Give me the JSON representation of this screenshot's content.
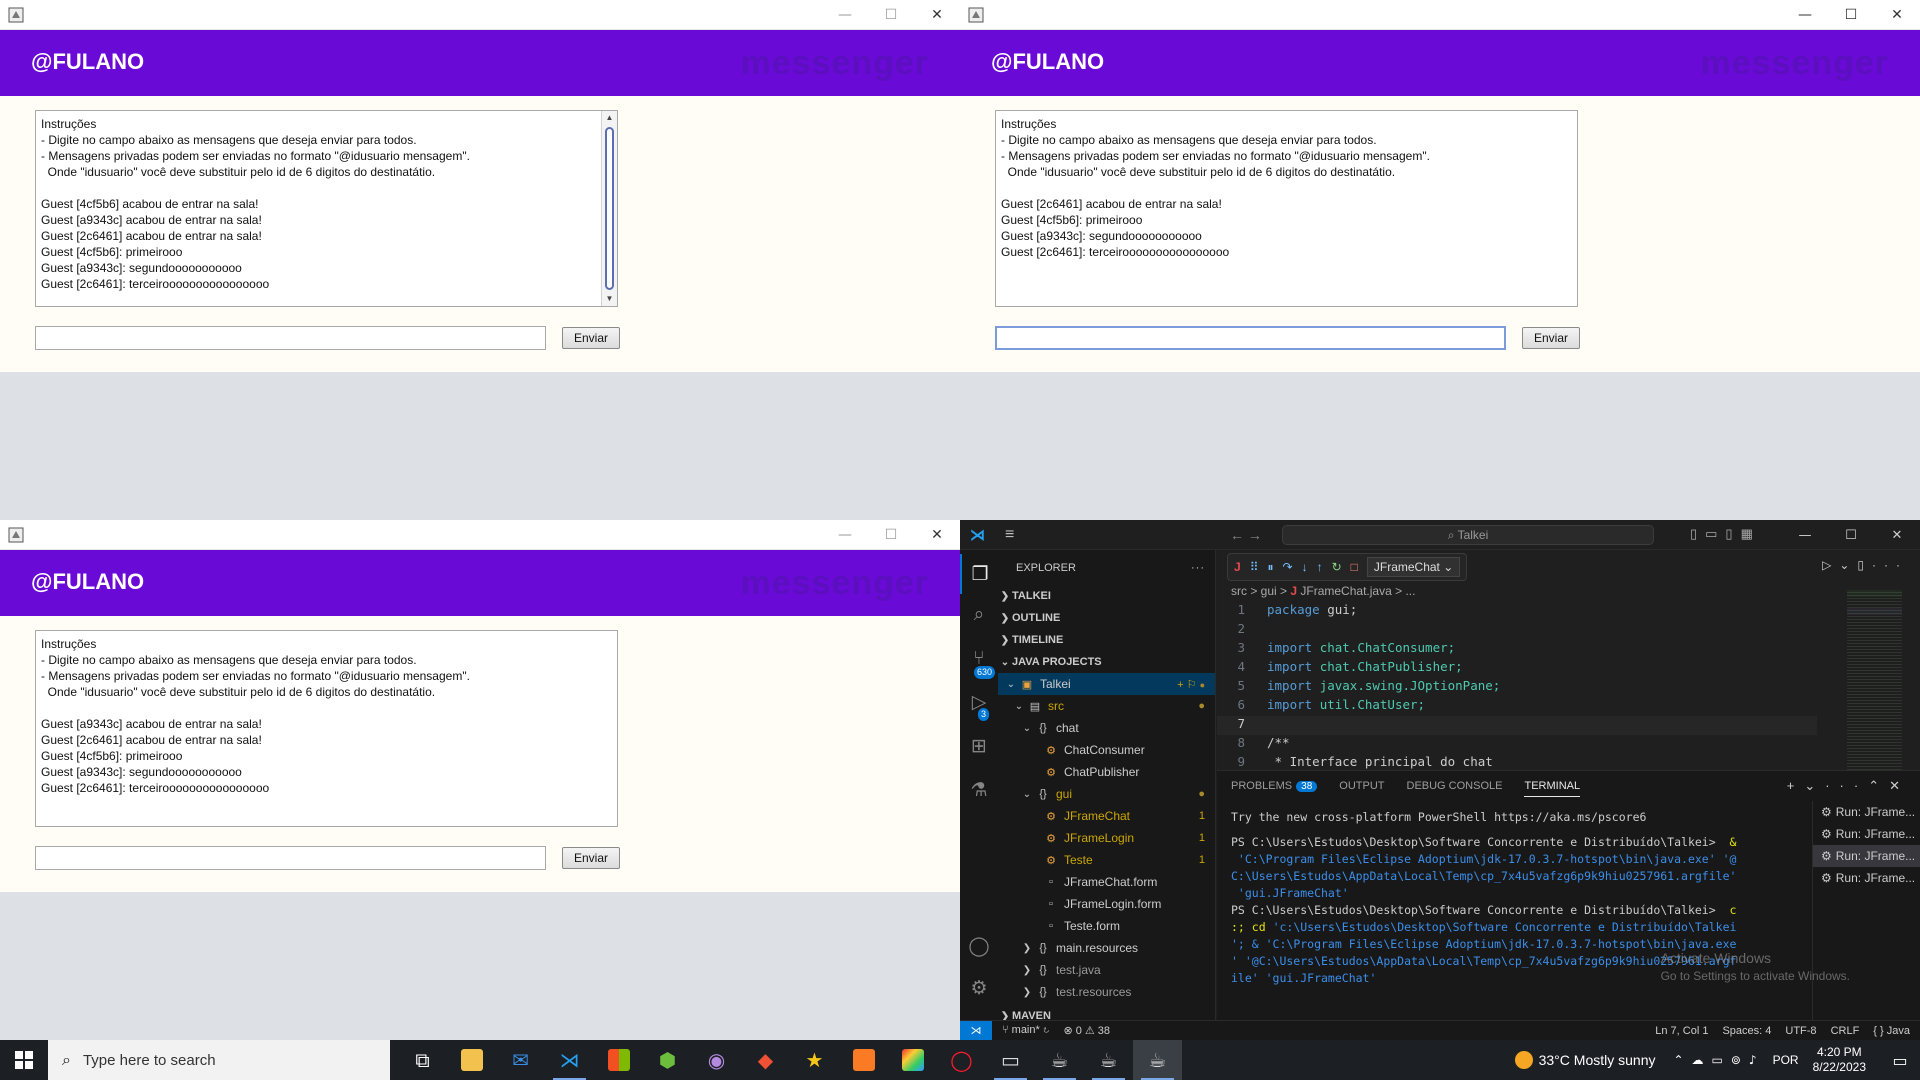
{
  "java_app": {
    "window_buttons": {
      "minimize": "—",
      "maximize": "☐",
      "close": "✕"
    },
    "user_handle": "@FULANO",
    "brand": "messenger",
    "send_label": "Enviar",
    "windows": [
      {
        "lines": [
          "Instruções",
          "- Digite no campo abaixo as mensagens que deseja enviar para todos.",
          "- Mensagens privadas podem ser enviadas no formato \"@idusuario mensagem\".",
          "  Onde \"idusuario\" você deve substituir pelo id de 6 digitos do destinatátio.",
          "",
          "Guest [4cf5b6] acabou de entrar na sala!",
          "Guest [a9343c] acabou de entrar na sala!",
          "Guest [2c6461] acabou de entrar na sala!",
          "Guest [4cf5b6]: primeirooo",
          "Guest [a9343c]: segundooooooooooo",
          "Guest [2c6461]: terceiroooooooooooooooo"
        ]
      },
      {
        "lines": [
          "Instruções",
          "- Digite no campo abaixo as mensagens que deseja enviar para todos.",
          "- Mensagens privadas podem ser enviadas no formato \"@idusuario mensagem\".",
          "  Onde \"idusuario\" você deve substituir pelo id de 6 digitos do destinatátio.",
          "",
          "Guest [2c6461] acabou de entrar na sala!",
          "Guest [4cf5b6]: primeirooo",
          "Guest [a9343c]: segundooooooooooo",
          "Guest [2c6461]: terceiroooooooooooooooo"
        ]
      },
      {
        "lines": [
          "Instruções",
          "- Digite no campo abaixo as mensagens que deseja enviar para todos.",
          "- Mensagens privadas podem ser enviadas no formato \"@idusuario mensagem\".",
          "  Onde \"idusuario\" você deve substituir pelo id de 6 digitos do destinatátio.",
          "",
          "Guest [a9343c] acabou de entrar na sala!",
          "Guest [2c6461] acabou de entrar na sala!",
          "Guest [4cf5b6]: primeirooo",
          "Guest [a9343c]: segundooooooooooo",
          "Guest [2c6461]: terceiroooooooooooooooo"
        ]
      }
    ]
  },
  "vscode": {
    "command_center": "Talkei",
    "explorer_title": "EXPLORER",
    "explorer_more": "···",
    "badges": {
      "source_control": "630",
      "run_debug": "3"
    },
    "sections": {
      "talkei": "TALKEI",
      "outline": "OUTLINE",
      "timeline": "TIMELINE",
      "java_projects": "JAVA PROJECTS",
      "maven": "MAVEN"
    },
    "tree": {
      "project": "Talkei",
      "src": "src",
      "chat": "chat",
      "chat_consumer": "ChatConsumer",
      "chat_publisher": "ChatPublisher",
      "gui": "gui",
      "jframe_chat": "JFrameChat",
      "jframe_login": "JFrameLogin",
      "teste": "Teste",
      "jframe_chat_form": "JFrameChat.form",
      "jframe_login_form": "JFrameLogin.form",
      "teste_form": "Teste.form",
      "main_resources": "main.resources",
      "test_java": "test.java",
      "test_resources": "test.resources",
      "problem_count": "1"
    },
    "debug_config": "JFrameChat",
    "breadcrumbs": "src > gui > ",
    "breadcrumb_file": "JFrameChat.java",
    "breadcrumb_tail": " > ...",
    "code": {
      "l1_kw": "package",
      "l1_rest": " gui;",
      "l3": "chat.ChatConsumer;",
      "l4": "chat.ChatPublisher;",
      "l5": "javax.swing.JOptionPane;",
      "l6": "util.ChatUser;",
      "import_kw": "import",
      "l8": "/**",
      "l9": " * Interface principal do chat"
    },
    "line_numbers": [
      "1",
      "2",
      "3",
      "4",
      "5",
      "6",
      "7",
      "8",
      "9"
    ],
    "panel_tabs": {
      "problems": "PROBLEMS",
      "problems_count": "38",
      "output": "OUTPUT",
      "debug_console": "DEBUG CONSOLE",
      "terminal": "TERMINAL"
    },
    "terminal": {
      "t1": "Try the new cross-platform PowerShell https://aka.ms/pscore6",
      "t2_prompt": "PS C:\\Users\\Estudos\\Desktop\\Software Concorrente e Distribuído\\Talkei> ",
      "t2_amp": " &",
      "t3": " 'C:\\Program Files\\Eclipse Adoptium\\jdk-17.0.3.7-hotspot\\bin\\java.exe' '@",
      "t4": "C:\\Users\\Estudos\\AppData\\Local\\Temp\\cp_7x4u5vafzg6p9k9hiu0257961.argfile'",
      "t5": " 'gui.JFrameChat'",
      "t6_prompt": "PS C:\\Users\\Estudos\\Desktop\\Software Concorrente e Distribuído\\Talkei> ",
      "t6_c": " c",
      "t7_a": ":; ",
      "t7_cd": "cd",
      "t7_b": " 'c:\\Users\\Estudos\\Desktop\\Software Concorrente e Distribuído\\Talkei",
      "t8_a": "'; & ",
      "t8_b": "'C:\\Program Files\\Eclipse Adoptium\\jdk-17.0.3.7-hotspot\\bin\\java.exe",
      "t9": "' '@C:\\Users\\Estudos\\AppData\\Local\\Temp\\cp_7x4u5vafzg6p9k9hiu0257961.argf",
      "t10": "ile' 'gui.JFrameChat'"
    },
    "terminal_instances": [
      "Run: JFrame...",
      "Run: JFrame...",
      "Run: JFrame...",
      "Run: JFrame..."
    ],
    "activate": {
      "title": "Activate Windows",
      "sub": "Go to Settings to activate Windows."
    },
    "status": {
      "branch": "main*",
      "problems": "⊗ 0 ⚠ 38",
      "position": "Ln 7, Col 1",
      "spaces": "Spaces: 4",
      "encoding": "UTF-8",
      "eol": "CRLF",
      "language": "{ } Java"
    }
  },
  "taskbar": {
    "search_placeholder": "Type here to search",
    "weather": "33°C  Mostly sunny",
    "language": "POR",
    "time": "4:20 PM",
    "date": "8/22/2023"
  }
}
